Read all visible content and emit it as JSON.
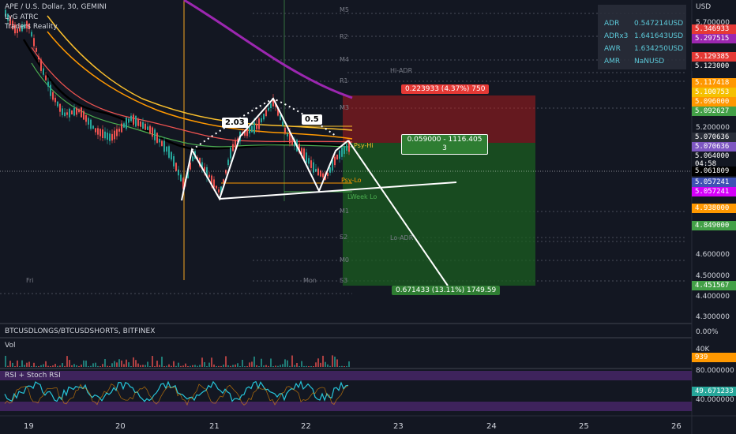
{
  "header": {
    "symbol_line": "APE / U.S. Dollar, 30, GEMINI",
    "indicator1": "LyG ATRC",
    "indicator2": "Traders Reality",
    "currency": "USD"
  },
  "stats": [
    {
      "label": "ADR",
      "value": "0.547214USD"
    },
    {
      "label": "ADRx3",
      "value": "1.641643USD"
    },
    {
      "label": "AWR",
      "value": "1.634250USD"
    },
    {
      "label": "AMR",
      "value": "NaNUSD"
    }
  ],
  "price_axis": {
    "plain_ticks": [
      "5.700000",
      "5.200000",
      "4.600000",
      "4.500000",
      "4.400000",
      "4.300000"
    ],
    "boxes": [
      {
        "text": "5.346933",
        "color": "#e53935"
      },
      {
        "text": "5.297515",
        "color": "#9c27b0"
      },
      {
        "text": "5.129385",
        "color": "#e53935"
      },
      {
        "text": "5.123000",
        "color": "#131722"
      },
      {
        "text": "5.117418",
        "color": "#ff9800"
      },
      {
        "text": "5.100753",
        "color": "#f5c000"
      },
      {
        "text": "5.096000",
        "color": "#ff9800"
      },
      {
        "text": "5.092627",
        "color": "#43a047"
      },
      {
        "text": "5.070636",
        "color": "#2a2e39"
      },
      {
        "text": "5.070636",
        "color": "#7e57c2"
      },
      {
        "text": "5.064000",
        "color": "#131722"
      },
      {
        "text": "04:58",
        "color": "#131722"
      },
      {
        "text": "5.061809",
        "color": "#000000"
      },
      {
        "text": "5.057241",
        "color": "#3f51b5"
      },
      {
        "text": "5.057241",
        "color": "#d500f9"
      },
      {
        "text": "4.938000",
        "color": "#ff9800"
      },
      {
        "text": "4.849000",
        "color": "#43a047"
      },
      {
        "text": "4.451567",
        "color": "#43a047"
      }
    ]
  },
  "pivot_labels": [
    "M5",
    "R2",
    "M4",
    "R1",
    "Hi-ADR",
    "M3",
    "Psy-Hi",
    "Psy-Lo",
    "LWeek Lo",
    "M1",
    "S2",
    "Lo-ADR",
    "M0",
    "S3"
  ],
  "day_labels": [
    "Fri",
    "Mon"
  ],
  "pattern_labels": {
    "left": "2.03",
    "right": "0.5"
  },
  "position": {
    "stop": "0.223933 (4.37%) 750",
    "entry": "0.059000 - 1116.405",
    "entry_qty": "3",
    "target": "0.671433 (13.11%) 1749.59"
  },
  "panes": {
    "btc": {
      "title": "BTCUSDLONGS/BTCUSDSHORTS, BITFINEX",
      "value": "0.00%"
    },
    "vol": {
      "title": "Vol",
      "value": "40K",
      "last": "939"
    },
    "rsi": {
      "title": "RSI + Stoch RSI",
      "upper": "80.000000",
      "value": "49.671233",
      "lower": "40.000000"
    }
  },
  "time_axis": [
    "19",
    "20",
    "21",
    "22",
    "23",
    "24",
    "25",
    "26"
  ],
  "colors": {
    "background": "#131722",
    "stop_zone": "#b71c1c",
    "target_zone": "#1b5e20",
    "pattern": "#ffffff",
    "ema_purple": "#9c27b0"
  }
}
